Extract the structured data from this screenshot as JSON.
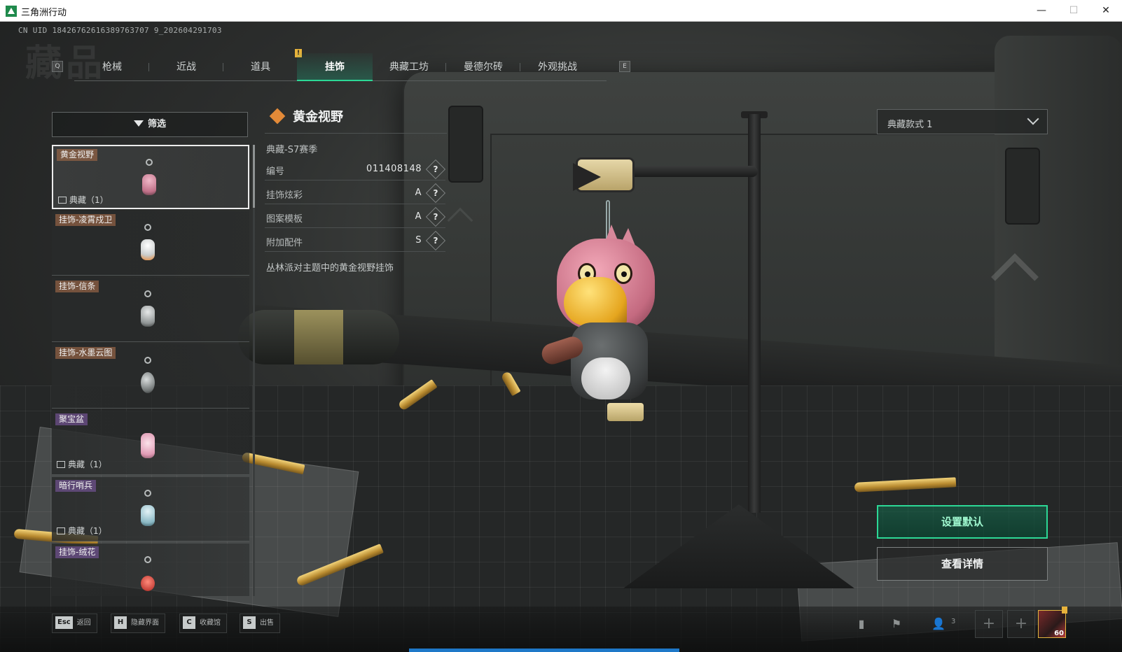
{
  "window": {
    "title": "三角洲行动",
    "minimize": "—",
    "maximize": "☐",
    "close": "✕"
  },
  "uid": "CN UID 18426762616389763707 9_202604291703",
  "bg_title": "藏品",
  "nav": {
    "prev_key": "Q",
    "next_key": "E",
    "alert": "!",
    "tabs": [
      {
        "label": "枪械",
        "active": false
      },
      {
        "label": "近战",
        "active": false
      },
      {
        "label": "道具",
        "active": false
      },
      {
        "label": "挂饰",
        "active": true
      },
      {
        "label": "典藏工坊",
        "active": false
      },
      {
        "label": "曼德尔砖",
        "active": false
      },
      {
        "label": "外观挑战",
        "active": false
      }
    ]
  },
  "filter": {
    "label": "筛选"
  },
  "items": [
    {
      "tag": "黄金视野",
      "collection": "典藏（1）",
      "selected": true,
      "color": "#e9a0b5"
    },
    {
      "tag": "挂饰-凌霄戍卫",
      "collection": "",
      "selected": false,
      "color": "#e8e8e8"
    },
    {
      "tag": "挂饰-信条",
      "collection": "",
      "selected": false,
      "color": "#c9cccc"
    },
    {
      "tag": "挂饰-水墨云图",
      "collection": "",
      "selected": false,
      "color": "#9aa0a0"
    },
    {
      "tag": "聚宝盆",
      "collection": "典藏（1）",
      "selected": false,
      "color": "#f0c8d8"
    },
    {
      "tag": "暗行哨兵",
      "collection": "典藏（1）",
      "selected": false,
      "color": "#b8d8e0"
    },
    {
      "tag": "挂饰-绒花",
      "collection": "",
      "selected": false,
      "color": "#c8443c"
    }
  ],
  "detail": {
    "title": "黄金视野",
    "season": "典藏-S7赛季",
    "rows": [
      {
        "key": "编号",
        "value": "011408148",
        "help": "?"
      },
      {
        "key": "挂饰炫彩",
        "value": "A",
        "help": "?"
      },
      {
        "key": "图案模板",
        "value": "A",
        "help": "?"
      },
      {
        "key": "附加配件",
        "value": "S",
        "help": "?"
      }
    ],
    "description": "丛林派对主题中的黄金视野挂饰"
  },
  "style_select": {
    "value": "典藏款式 1"
  },
  "actions": {
    "set_default": "设置默认",
    "view_details": "查看详情"
  },
  "hints": [
    {
      "key": "Esc",
      "label": "返回"
    },
    {
      "key": "H",
      "label": "隐藏界面"
    },
    {
      "key": "C",
      "label": "收藏馆"
    },
    {
      "key": "S",
      "label": "出售"
    }
  ],
  "bottom_right": {
    "squad_count": "3",
    "avatar_level": "60",
    "add": "+"
  },
  "colors": {
    "accent_green": "#2cd896",
    "tab_alert": "#e7b23b",
    "title_diamond": "#e38a38"
  }
}
